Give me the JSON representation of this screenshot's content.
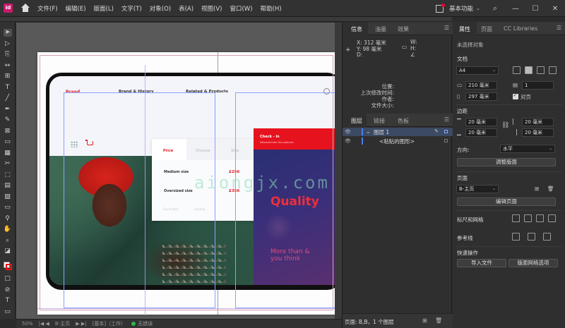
{
  "app": {
    "logo": "Id",
    "menus": [
      "文件(F)",
      "编辑(E)",
      "版面(L)",
      "文字(T)",
      "对象(O)",
      "表(A)",
      "视图(V)",
      "窗口(W)",
      "帮助(H)"
    ],
    "workspace": "基本功能",
    "window_controls": [
      "—",
      "☐",
      "✕"
    ]
  },
  "tools": [
    "select",
    "direct-select",
    "page",
    "gap",
    "content-collector",
    "type",
    "line",
    "pen",
    "pencil",
    "rect-frame",
    "rectangle",
    "scissors",
    "free-transform",
    "gradient-swatch",
    "gradient-feather",
    "note",
    "eyedropper",
    "hand",
    "zoom"
  ],
  "design": {
    "brand": "Brand",
    "nav_links": [
      "Brand & History",
      "Related & Products"
    ],
    "price_tabs": [
      "Price",
      "Choose",
      "Size"
    ],
    "price_rows": [
      {
        "label": "Medium size",
        "price": "£256"
      },
      {
        "label": "Oversized size",
        "price": "£356"
      }
    ],
    "price_footer": [
      "Favorable",
      "Quality"
    ],
    "checkout_title": "Check - in",
    "checkout_sub": "Selected from the products",
    "checkout_arrow": "→",
    "quality_text": "Quality",
    "more_than_line1": "More than &",
    "more_than_line2": "you think",
    "watermark": "aiongjx.com"
  },
  "status": {
    "zoom": "50%",
    "page": "B-主页",
    "mode": "[基本]（工作）",
    "errors": "无错误"
  },
  "info_panel": {
    "tabs": [
      "信息",
      "油墨",
      "效果"
    ],
    "x": "X: 312 毫米",
    "y": "Y: 98 毫米",
    "d": "D:",
    "w": "W:",
    "h": "H:",
    "angle": "∠",
    "meta_labels": [
      "位置:",
      "上次修改时间:",
      "作者:",
      "文件大小:"
    ]
  },
  "layers_panel": {
    "tabs": [
      "图层",
      "链接",
      "色板"
    ],
    "layers": [
      {
        "name": "图层 1"
      },
      {
        "name": "<粘贴的图形>"
      }
    ],
    "footer": "页面: B,B，1 个图层"
  },
  "properties_panel": {
    "tabs": [
      "属性",
      "页面",
      "CC Libraries"
    ],
    "no_selection": "未选择对象",
    "document_label": "文档",
    "page_size": "A4",
    "width": "210 毫米",
    "height": "297 毫米",
    "pages_count": "1",
    "facing_pages": "对页",
    "margins_label": "边距",
    "margin_top": "20 毫米",
    "margin_bottom": "20 毫米",
    "margin_left": "20 毫米",
    "margin_right": "20 毫米",
    "orientation_label": "方向:",
    "orientation_value": "水平",
    "adjust_layout_button": "调整版面",
    "page_label": "页面",
    "master_page": "B-主页",
    "edit_page_button": "编辑页面",
    "rulers_grids_label": "标尺和网格",
    "guides_label": "参考线",
    "quick_actions_label": "快速操作",
    "import_file_button": "导入文件",
    "layout_grid_button": "版面网格选项"
  },
  "colors": {
    "accent_red": "#e21b23",
    "panel_bg": "#2f2f2f",
    "selection_blue": "#8ca0ff"
  }
}
